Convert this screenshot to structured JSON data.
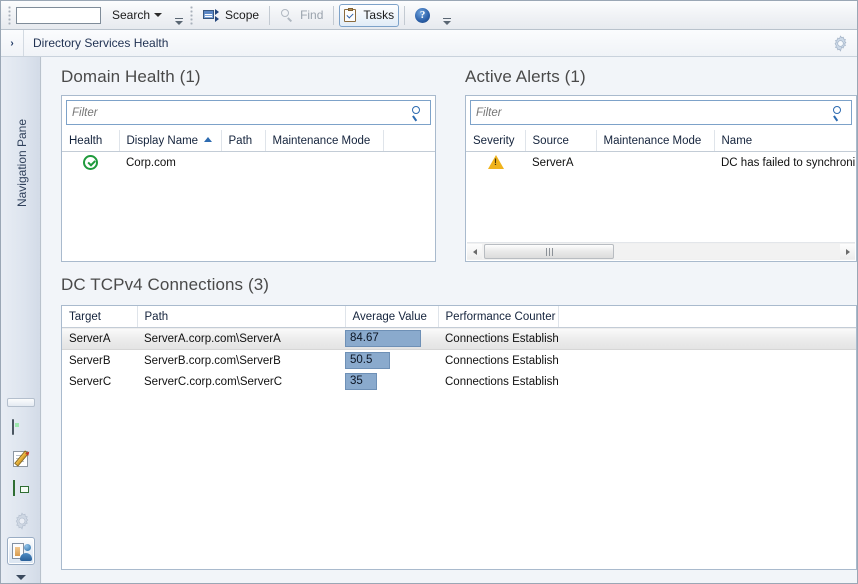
{
  "toolbar": {
    "search_value": "",
    "search_placeholder": "",
    "search_label": "Search",
    "scope_label": "Scope",
    "find_label": "Find",
    "tasks_label": "Tasks",
    "help_label": "?",
    "icons": {
      "scope": "scope-icon",
      "find": "magnifier-icon",
      "tasks": "clipboard-check-icon",
      "help": "help-circle-icon",
      "overflow": "toolbar-overflow-icon"
    }
  },
  "header": {
    "expand_glyph": "›",
    "title": "Directory Services Health",
    "gear_icon": "gear-icon"
  },
  "navigation_pane": {
    "expand_glyph": "›",
    "vertical_label": "Navigation Pane",
    "more_glyph": "▼",
    "workspaces": [
      {
        "name": "monitoring",
        "icon": "monitor-icon",
        "selected": false
      },
      {
        "name": "authoring",
        "icon": "pencil-document-icon",
        "selected": false
      },
      {
        "name": "reporting",
        "icon": "green-book-icon",
        "selected": false
      },
      {
        "name": "administration",
        "icon": "gear-icon",
        "selected": false
      },
      {
        "name": "my-workspace",
        "icon": "person-card-icon",
        "selected": true
      }
    ]
  },
  "domain_health": {
    "title": "Domain Health (1)",
    "filter": {
      "value": "",
      "placeholder": "Filter",
      "icon": "magnifier-icon"
    },
    "columns": [
      "Health",
      "Display Name",
      "Path",
      "Maintenance Mode",
      ""
    ],
    "sorted_column": "Display Name",
    "sort_direction": "asc",
    "rows": [
      {
        "health": "healthy",
        "health_icon": "green-check-circle-icon",
        "display_name": "Corp.com",
        "path": "",
        "maintenance_mode": "",
        "extra": ""
      }
    ]
  },
  "active_alerts": {
    "title": "Active Alerts (1)",
    "filter": {
      "value": "",
      "placeholder": "Filter",
      "icon": "magnifier-icon"
    },
    "columns": [
      "Severity",
      "Source",
      "Maintenance Mode",
      "Name"
    ],
    "rows": [
      {
        "severity": "warning",
        "severity_icon": "warning-triangle-icon",
        "source": "ServerA",
        "maintenance_mode": "",
        "name": "DC has failed to synchroni"
      }
    ],
    "scrollbar": {
      "left_arrow": "◀",
      "right_arrow": "▶",
      "position": "left"
    }
  },
  "dc_connections": {
    "title": "DC TCPv4 Connections (3)",
    "columns": [
      "Target",
      "Path",
      "Average Value",
      "Performance Counter",
      ""
    ],
    "rows": [
      {
        "target": "ServerA",
        "path": "ServerA.corp.com\\ServerA",
        "average_value": "84.67",
        "average_value_number": 84.67,
        "performance_counter": "Connections Established",
        "selected": true
      },
      {
        "target": "ServerB",
        "path": "ServerB.corp.com\\ServerB",
        "average_value": "50.5",
        "average_value_number": 50.5,
        "performance_counter": "Connections Established",
        "selected": false
      },
      {
        "target": "ServerC",
        "path": "ServerC.corp.com\\ServerC",
        "average_value": "35",
        "average_value_number": 35,
        "performance_counter": "Connections Established",
        "selected": false
      }
    ],
    "bar_max": 100,
    "bar_color": "#8aaacd"
  },
  "chart_data": {
    "type": "bar",
    "title": "DC TCPv4 Connections (3)",
    "categories": [
      "ServerA",
      "ServerB",
      "ServerC"
    ],
    "values": [
      84.67,
      50.5,
      35
    ],
    "xlabel": "Target",
    "ylabel": "Average Value",
    "ylim": [
      0,
      100
    ],
    "grid": false,
    "legend": "none",
    "series": [
      {
        "name": "Connections Established",
        "values": [
          84.67,
          50.5,
          35
        ]
      }
    ]
  },
  "colors": {
    "page_background": "#f2f5f9",
    "panel_border": "#a9bacd",
    "accent_blue": "#2c6ab0",
    "title_text": "#4a4a4a",
    "header_text": "#1f3152",
    "healthy_green": "#1f9a3c",
    "warning_amber": "#f0b31c",
    "data_bar": "#8aaacd"
  }
}
